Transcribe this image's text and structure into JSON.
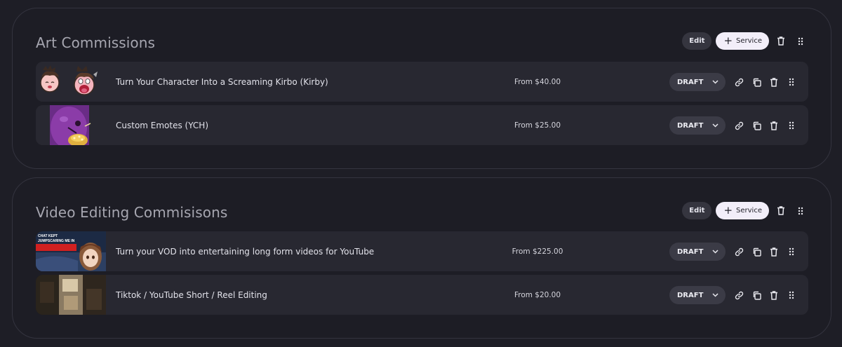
{
  "sections": [
    {
      "title": "Art Commissions",
      "edit_label": "Edit",
      "service_label": "Service",
      "rows": [
        {
          "title": "Turn Your Character Into a Screaming Kirbo (Kirby)",
          "price": "From $40.00",
          "status": "DRAFT",
          "thumbnail": "kirby-character-image"
        },
        {
          "title": "Custom Emotes (YCH)",
          "price": "From $25.00",
          "status": "DRAFT",
          "thumbnail": "purple-emote-image"
        }
      ]
    },
    {
      "title": "Video Editing Commisisons",
      "edit_label": "Edit",
      "service_label": "Service",
      "rows": [
        {
          "title": "Turn your VOD into entertaining long form videos for YouTube",
          "price": "From $225.00",
          "status": "DRAFT",
          "thumbnail": "youtube-thumbnail-image",
          "thumbnail_text": "CHAT KEPT JUMPSCARING ME IN"
        },
        {
          "title": "Tiktok / YouTube Short / Reel Editing",
          "price": "From $20.00",
          "status": "DRAFT",
          "thumbnail": "short-video-collage-image"
        }
      ]
    }
  ],
  "colors": {
    "background": "#1e1e26",
    "row": "#282831",
    "edit_button": "#35353f",
    "service_button": "#f2eef9"
  },
  "icons": [
    "plus-icon",
    "trash-icon",
    "drag-handle-icon",
    "chevron-down-icon",
    "link-icon",
    "copy-icon"
  ]
}
